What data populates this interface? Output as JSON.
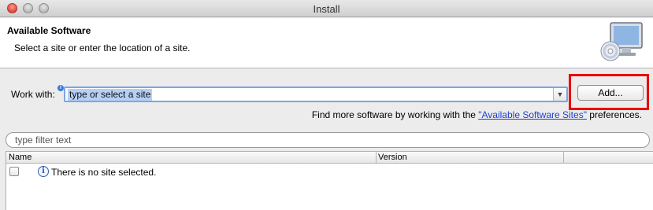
{
  "window": {
    "title": "Install"
  },
  "header": {
    "title": "Available Software",
    "description": "Select a site or enter the location of a site."
  },
  "work_with": {
    "label": "Work with:",
    "value": "type or select a site",
    "add_button": "Add...",
    "find_more_prefix": "Find more software by working with the ",
    "find_more_link": "\"Available Software Sites\"",
    "find_more_suffix": " preferences."
  },
  "filter": {
    "placeholder": "type filter text"
  },
  "table": {
    "columns": [
      "Name",
      "Version"
    ],
    "rows": [
      {
        "checked": false,
        "text": "There is no site selected."
      }
    ]
  },
  "colors": {
    "highlight": "#e8000b",
    "link": "#1a3fcf",
    "selection": "#b5cff5"
  }
}
